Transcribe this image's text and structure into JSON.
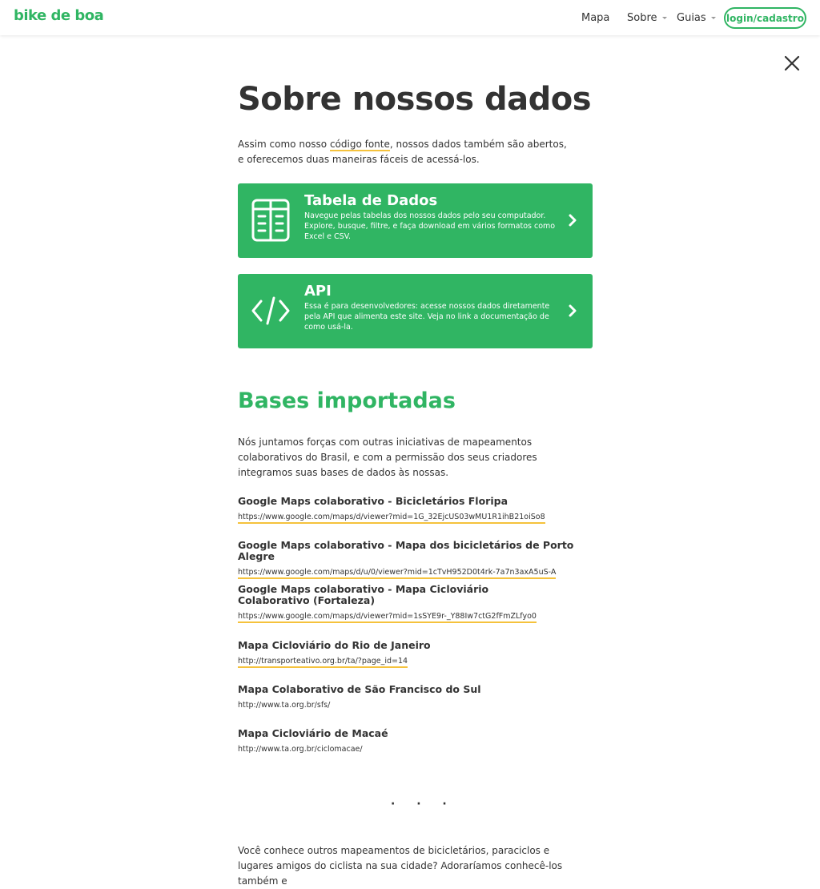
{
  "header": {
    "logo": "bike de boa",
    "nav": {
      "mapa": "Mapa",
      "sobre": "Sobre",
      "guias": "Guias",
      "login": "login/cadastro"
    }
  },
  "page": {
    "title": "Sobre nossos dados",
    "intro_before": "Assim como nosso ",
    "intro_link": "código fonte",
    "intro_after": ", nossos dados também são abertos, e oferecemos duas maneiras fáceis de acessá-los."
  },
  "cards": [
    {
      "title": "Tabela de Dados",
      "description": "Navegue pelas tabelas dos nossos dados pelo seu computador. Explore, busque, filtre, e faça download em vários formatos como Excel e CSV.",
      "icon": "spreadsheet-icon"
    },
    {
      "title": "API",
      "description": "Essa é para desenvolvedores: acesse nossos dados diretamente pela API que alimenta este site. Veja no link a documentação de como usá-la.",
      "icon": "code-icon"
    }
  ],
  "bases": {
    "title": "Bases importadas",
    "description": "Nós juntamos forças com outras iniciativas de mapeamentos colaborativos do Brasil, e com a permissão dos seus criadores integramos suas bases de dados às nossas.",
    "items": [
      {
        "name": "Google Maps colaborativo - Bicicletários Floripa",
        "url": "https://www.google.com/maps/d/viewer?mid=1G_32EjcUS03wMU1R1ihB21oiSo8"
      },
      {
        "name": "Google Maps colaborativo - Mapa dos bicicletários de Porto Alegre",
        "url": "https://www.google.com/maps/d/u/0/viewer?mid=1cTvH952D0t4rk-7a7n3axA5uS-A"
      },
      {
        "name": "Google Maps colaborativo - Mapa Cicloviário Colaborativo (Fortaleza)",
        "url": "https://www.google.com/maps/d/viewer?mid=1sSYE9r-_Y88Iw7ctG2fFmZLfyo0"
      },
      {
        "name": "Mapa Cicloviário do Rio de Janeiro",
        "url": "http://transporteativo.org.br/ta/?page_id=14"
      },
      {
        "name": "Mapa Colaborativo de São Francisco do Sul",
        "url": "http://www.ta.org.br/sfs/"
      },
      {
        "name": "Mapa Cicloviário de Macaé",
        "url": "http://www.ta.org.br/ciclomacae/"
      }
    ]
  },
  "separator": "· · ·",
  "outro": "Você conhece outros mapeamentos de bicicletários, paraciclos e lugares amigos do ciclista na sua cidade? Adoraríamos conhecê-los também e",
  "colors": {
    "brand_green": "#30b563",
    "link_underline": "#f5c23c",
    "text": "#333333"
  }
}
